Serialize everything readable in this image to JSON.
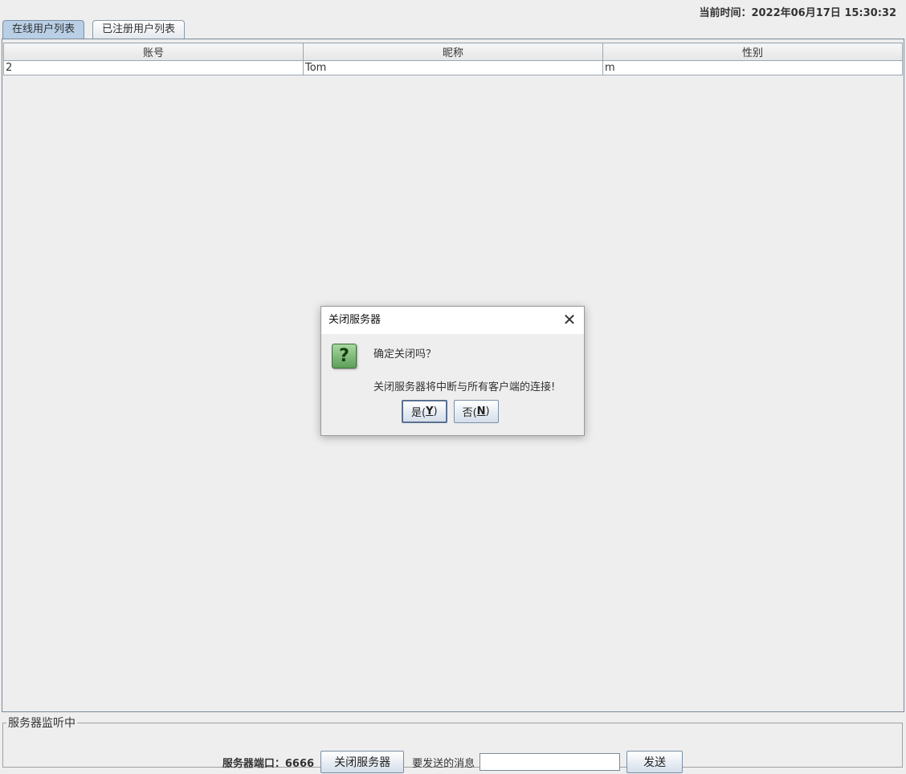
{
  "header": {
    "clock": "当前时间：2022年06月17日 15:30:32"
  },
  "tabs": [
    {
      "label": "在线用户列表",
      "active": true
    },
    {
      "label": "已注册用户列表",
      "active": false
    }
  ],
  "table": {
    "columns": [
      "账号",
      "昵称",
      "性别"
    ],
    "rows": [
      [
        "2",
        "Tom",
        "m"
      ]
    ]
  },
  "status_panel": {
    "legend": "服务器监听中",
    "port_label": "服务器端口：6666",
    "close_button": "关闭服务器",
    "message_label": "要发送的消息",
    "message_value": "",
    "send_button": "发送"
  },
  "dialog": {
    "title": "关闭服务器",
    "question": "确定关闭吗？",
    "detail": "关闭服务器将中断与所有客户端的连接!",
    "yes_prefix": "是(",
    "yes_mnemonic": "Y",
    "no_prefix": "否(",
    "no_mnemonic": "N",
    "close_symbol": "✕",
    "icon": "question-icon"
  }
}
